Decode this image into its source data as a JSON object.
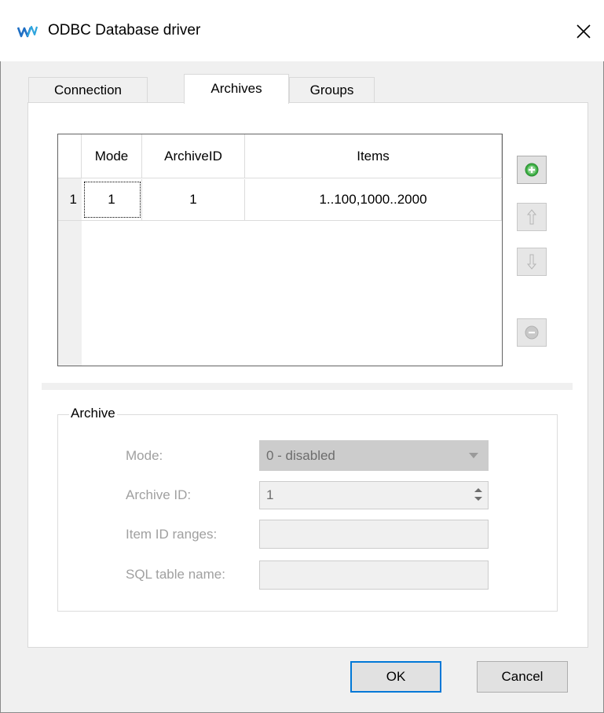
{
  "window": {
    "title": "ODBC Database driver",
    "icon": "app-logo-icon",
    "close_icon": "close-icon"
  },
  "tabs": [
    {
      "label": "Connection",
      "active": false
    },
    {
      "label": "Archives",
      "active": true
    },
    {
      "label": "Groups",
      "active": false
    }
  ],
  "grid": {
    "columns": [
      "",
      "Mode",
      "ArchiveID",
      "Items"
    ],
    "rows": [
      {
        "num": "1",
        "mode": "1",
        "archive_id": "1",
        "items": "1..100,1000..2000"
      }
    ]
  },
  "side_buttons": [
    {
      "name": "add",
      "icon": "plus-circle-icon",
      "enabled": true
    },
    {
      "name": "move-up",
      "icon": "arrow-up-icon",
      "enabled": false
    },
    {
      "name": "move-down",
      "icon": "arrow-down-icon",
      "enabled": false
    },
    {
      "name": "remove",
      "icon": "minus-circle-icon",
      "enabled": false
    }
  ],
  "archive_group": {
    "title": "Archive",
    "mode_label": "Mode:",
    "mode_value": "0 - disabled",
    "archive_id_label": "Archive ID:",
    "archive_id_value": "1",
    "item_ranges_label": "Item ID ranges:",
    "item_ranges_value": "",
    "sql_table_label": "SQL table name:",
    "sql_table_value": ""
  },
  "buttons": {
    "ok": "OK",
    "cancel": "Cancel"
  },
  "colors": {
    "accent": "#0078d7",
    "add_green": "#3cb043",
    "disabled_text": "#a0a0a0"
  }
}
